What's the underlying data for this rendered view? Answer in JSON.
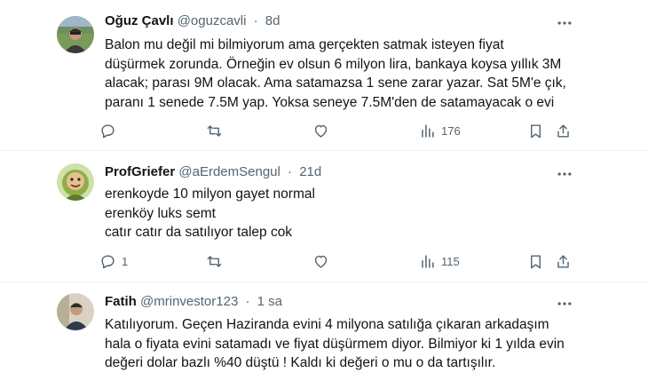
{
  "tweets": [
    {
      "name": "Oğuz Çavlı",
      "handle": "@oguzcavli",
      "separator": "·",
      "time": "8d",
      "lines": [
        "Balon mu değil mi bilmiyorum ama gerçekten satmak isteyen fiyat",
        "düşürmek zorunda. Örneğin ev olsun 6 milyon lira, bankaya koysa yıllık 3M",
        "alacak; parası 9M olacak. Ama satamazsa 1 sene zarar yazar. Sat 5M'e çık,",
        "paranı 1 senede 7.5M yap. Yoksa seneye 7.5M'den de satamayacak o evi"
      ],
      "replies": "",
      "views": "176"
    },
    {
      "name": "ProfGriefer",
      "handle": "@aErdemSengul",
      "separator": "·",
      "time": "21d",
      "lines": [
        "erenkoyde 10 milyon gayet normal",
        "erenköy luks semt",
        "catır catır da satılıyor talep cok"
      ],
      "replies": "1",
      "views": "115"
    },
    {
      "name": "Fatih",
      "handle": "@mrinvestor123",
      "separator": "·",
      "time": "1 sa",
      "lines": [
        "Katılıyorum. Geçen Haziranda evini 4 milyona satılığa çıkaran arkadaşım",
        "hala o fiyata evini satamadı ve fiyat düşürmem diyor. Bilmiyor ki 1 yılda evin",
        "değeri dolar bazlı %40 düştü ! Kaldı ki değeri o mu o da tartışılır."
      ]
    }
  ],
  "icons": {
    "reply": "reply-icon",
    "retweet": "retweet-icon",
    "like": "heart-icon",
    "views": "views-icon",
    "bookmark": "bookmark-icon",
    "share": "share-icon",
    "more": "more-options-icon"
  },
  "colors": {
    "text_primary": "#0f1419",
    "text_secondary": "#536471",
    "divider": "#eff3f4"
  }
}
